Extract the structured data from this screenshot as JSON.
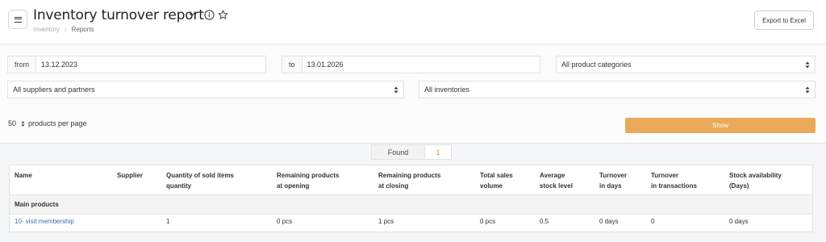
{
  "header": {
    "title": "Inventory turnover report",
    "breadcrumb": [
      "Inventory",
      "Reports"
    ],
    "export_label": "Export to Excel"
  },
  "filters": {
    "from_label": "from",
    "from_value": "13.12.2023",
    "to_label": "to",
    "to_value": "13.01.2026",
    "category": "All product categories",
    "supplier": "All suppliers and partners",
    "inventory": "All inventories",
    "per_page_value": "50",
    "per_page_label": "products per page",
    "show_label": "Show"
  },
  "found": {
    "label": "Found",
    "count": "1"
  },
  "table": {
    "columns": [
      [
        "Name"
      ],
      [
        "Supplier"
      ],
      [
        "Quantity of sold items",
        "quantity"
      ],
      [
        "Remaining products",
        "at opening"
      ],
      [
        "Remaining products",
        "at closing"
      ],
      [
        "Total sales",
        "volume"
      ],
      [
        "Average",
        "stock level"
      ],
      [
        "Turnover",
        "in days"
      ],
      [
        "Turnover",
        "in transactions"
      ],
      [
        "Stock availability",
        "(Days)"
      ]
    ],
    "group": "Main products",
    "rows": [
      [
        "10- visit membership",
        "",
        "1",
        "0 pcs",
        "1 pcs",
        "0 pcs",
        "0.5",
        "0 days",
        "0",
        "0 days"
      ]
    ]
  },
  "colors": {
    "accent": "#eba95a",
    "link": "#3a6fb0",
    "count": "#e88a2e"
  }
}
